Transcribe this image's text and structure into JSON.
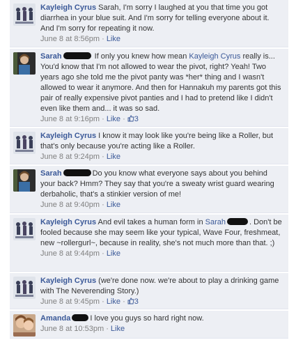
{
  "comments": [
    {
      "author": "Kayleigh Cyrus",
      "avatar": "skaters-avatar",
      "text": "Sarah, I'm sorry I laughed at you that time you got diarrhea in your blue suit. And I'm sorry for telling everyone about it. And I'm sorry for repeating it now.",
      "time": "June 8 at 8:56pm",
      "like": "Like",
      "likes": ""
    },
    {
      "author": "Sarah",
      "avatar": "sarah-avatar",
      "text_a": "If only you knew how mean",
      "mention": "Kayleigh Cyrus",
      "text_b": "really is... You'd know that I'm not allowed to wear the pivot, right? Yeah! Two years ago she told me the pivot panty was *her* thing and I wasn't allowed to wear it anymore. And then for Hannakuh my parents got this pair of really expensive pivot panties and I had to pretend like I didn't even like them and... it was so sad.",
      "time": "June 8 at 9:16pm",
      "like": "Like",
      "likes": "3"
    },
    {
      "author": "Kayleigh Cyrus",
      "avatar": "skaters-avatar",
      "text": "I know it may look like you're being like a Roller, but that's only because you're acting like a Roller.",
      "time": "June 8 at 9:24pm",
      "like": "Like",
      "likes": ""
    },
    {
      "author": "Sarah",
      "avatar": "sarah-avatar",
      "text": "Do you know what everyone says about you behind your back? Hmm? They say that you're a sweaty wrist guard wearing derbaholic, that's a stinkier version of me!",
      "time": "June 8 at 9:40pm",
      "like": "Like",
      "likes": ""
    },
    {
      "author": "Kayleigh Cyrus",
      "avatar": "skaters-avatar",
      "text_a": "And evil takes a human form in",
      "mention": "Sarah",
      "text_b": ". Don't be fooled because she may seem like your typical, Wave Four, freshmeat, new ~rollergurl~, because in reality, she's not much more than that. ;)",
      "time": "June 8 at 9:44pm",
      "like": "Like",
      "likes": ""
    },
    {
      "author": "Kayleigh Cyrus",
      "avatar": "skaters-avatar",
      "text": "(we're done now. we're about to play a drinking game with The Neverending Story.)",
      "time": "June 8 at 9:45pm",
      "like": "Like",
      "likes": "3"
    },
    {
      "author": "Amanda",
      "avatar": "amanda-avatar",
      "text": "I love you guys so hard right now.",
      "time": "June 8 at 10:53pm",
      "like": "Like",
      "likes": ""
    }
  ],
  "colors": {
    "link": "#3b5998",
    "background": "#edeff4",
    "meta": "#808080"
  }
}
